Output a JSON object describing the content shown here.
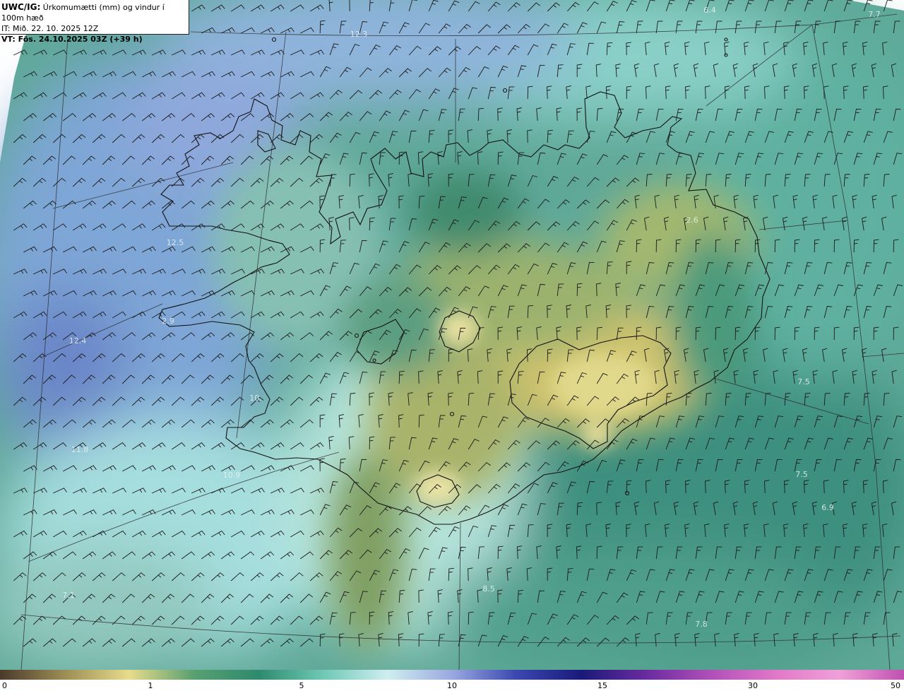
{
  "header": {
    "product": "UWC/IG:",
    "description": "Úrkomumætti (mm) og vindur í 100m hæð",
    "issue_time": "IT: Mið. 22. 10. 2025 12Z",
    "valid_prefix": "VT:",
    "valid_time": "Fös. 24.10.2025 03Z (+39 h)"
  },
  "map_labels": [
    "6.4",
    "7.7",
    "12.3",
    "2.6",
    "12.5",
    "12.4",
    "2.9",
    "7.5",
    "10.",
    "11.8",
    "10.9",
    "7.5",
    "6.9",
    "7.1",
    "8.5",
    "7.8"
  ],
  "colorbar": {
    "unit": "mm",
    "ticks": [
      "0",
      "1",
      "5",
      "10",
      "15",
      "30",
      "50"
    ],
    "colors": [
      "#4a3a2a",
      "#9c8c55",
      "#e8dc8c",
      "#5aa070",
      "#2e8a6e",
      "#6ec8b4",
      "#cfeef0",
      "#9aa8e0",
      "#3a48b0",
      "#1a1a7a",
      "#6a2aa0",
      "#b050b8",
      "#e078c8",
      "#f0a0d8",
      "#c050b0"
    ]
  }
}
